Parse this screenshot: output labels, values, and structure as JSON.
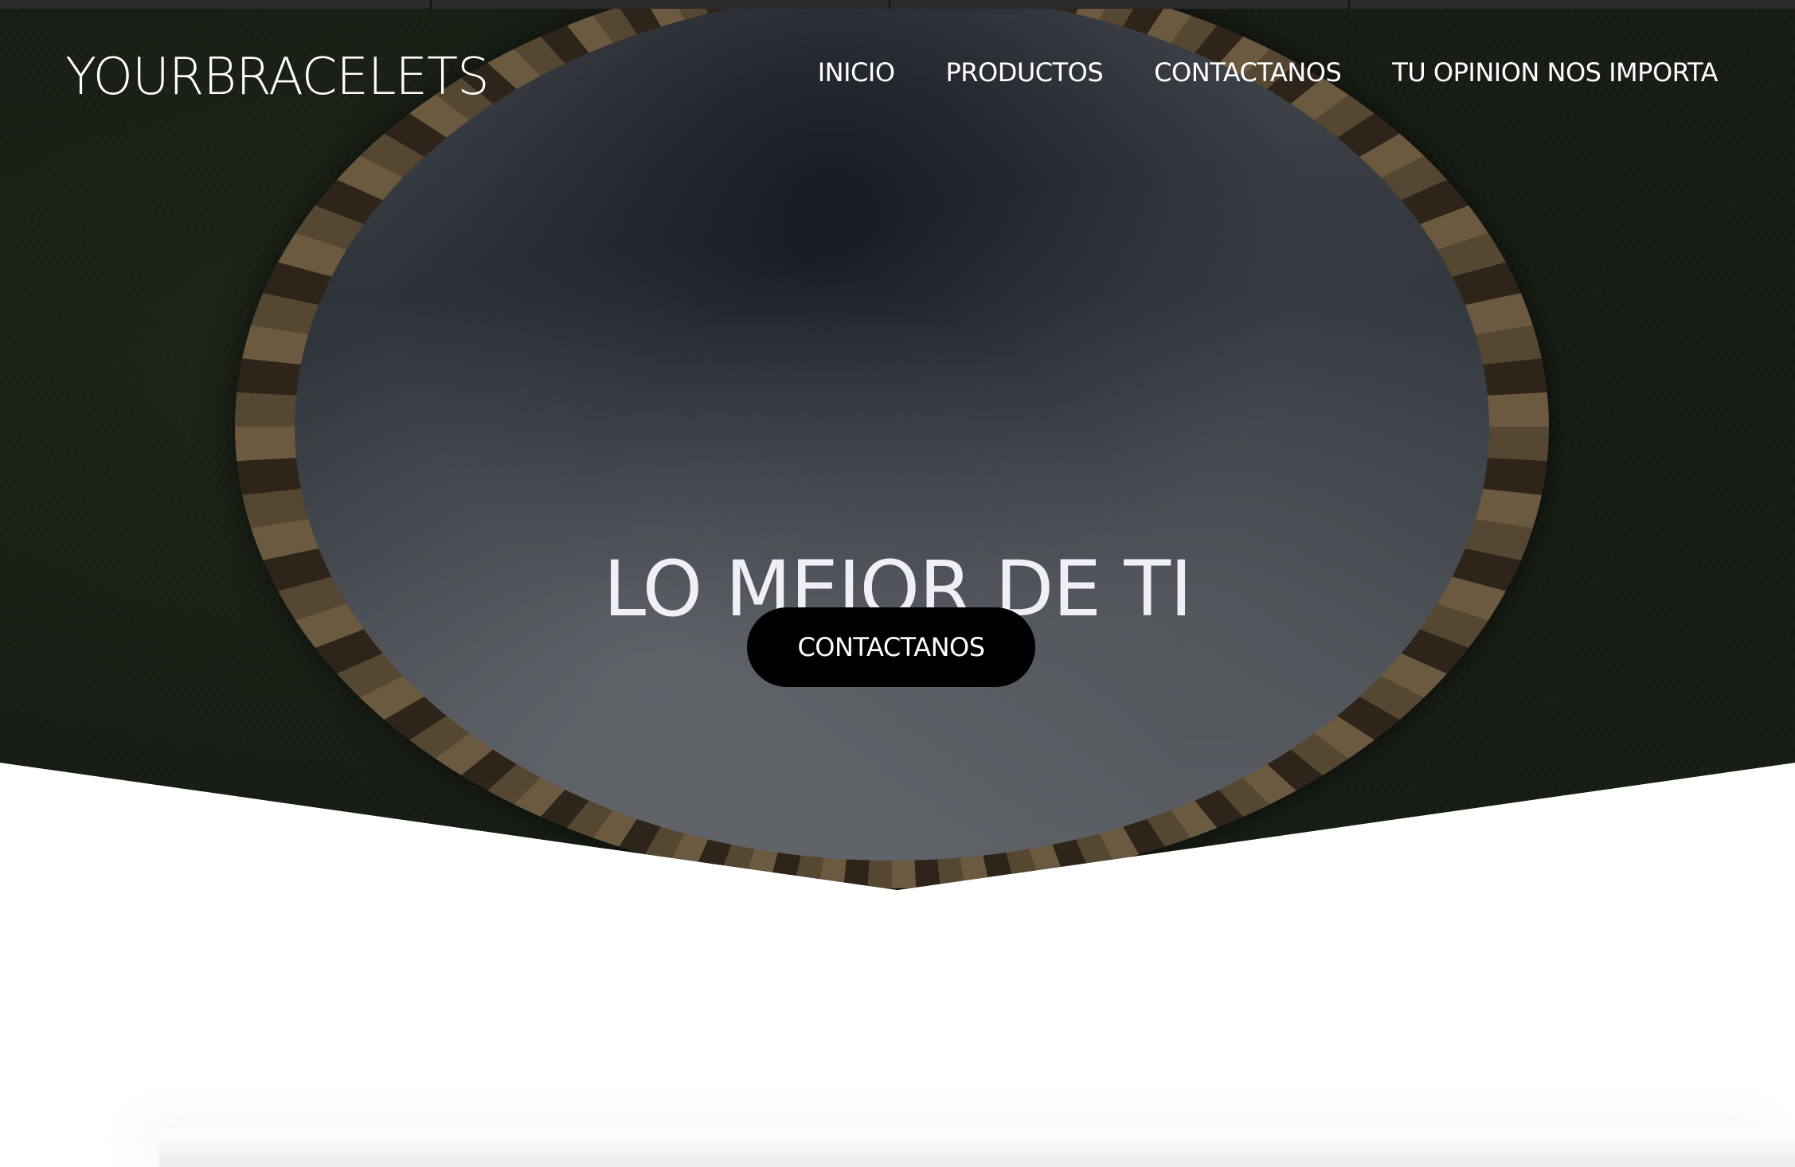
{
  "header": {
    "brand": "YOURBRACELETS",
    "nav": [
      {
        "label": "INICIO"
      },
      {
        "label": "PRODUCTOS"
      },
      {
        "label": "CONTACTANOS"
      },
      {
        "label": "TU OPINION NOS IMPORTA"
      }
    ]
  },
  "hero": {
    "title": "LO MEJOR DE TI",
    "cta_label": "CONTACTANOS",
    "background_image": "mirror-on-grass"
  },
  "colors": {
    "cta_background": "#000000",
    "text": "#ffffff",
    "page_background": "#ffffff"
  }
}
